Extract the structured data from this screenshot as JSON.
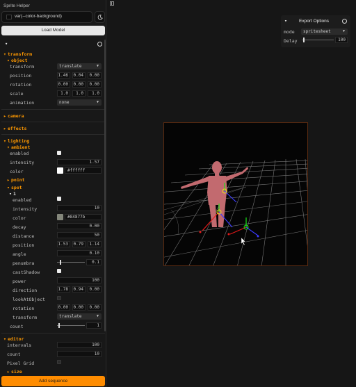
{
  "app": {
    "title": "Sprite Helper"
  },
  "background": {
    "value": "var(--color-background)"
  },
  "buttons": {
    "load_model": "Load Model",
    "add_sequence": "Add sequence"
  },
  "gui": {
    "transform_folder": "transform",
    "object_folder": "object",
    "object": {
      "transform_label": "transform",
      "transform_value": "translate",
      "position_label": "position",
      "position": [
        "1.46",
        "0.04",
        "0.00"
      ],
      "rotation_label": "rotation",
      "rotation": [
        "0.00",
        "0.00",
        "0.00"
      ],
      "scale_label": "scale",
      "scale": [
        "1.0",
        "1.0",
        "1.0"
      ],
      "animation_label": "animation",
      "animation_value": "none"
    },
    "camera_folder": "camera",
    "effects_folder": "effects",
    "lighting_folder": "lighting",
    "ambient_folder": "ambient",
    "ambient": {
      "enabled_label": "enabled",
      "enabled": true,
      "intensity_label": "intensity",
      "intensity": "1.57",
      "color_label": "color",
      "color": "#ffffff"
    },
    "point_folder": "point",
    "spot_folder": "spot",
    "spot_sub_folder": "1",
    "spot": {
      "enabled_label": "enabled",
      "enabled": true,
      "intensity_label": "intensity",
      "intensity": "10",
      "color_label": "color",
      "color": "#84877b",
      "decay_label": "decay",
      "decay": "0.00",
      "distance_label": "distance",
      "distance": "50",
      "position_label": "position",
      "position": [
        "1.53",
        "0.79",
        "1.14"
      ],
      "angle_label": "angle",
      "angle": "0.10",
      "penumbra_label": "penumbra",
      "penumbra": "0.1",
      "penumbra_level": 0.1,
      "castshadow_label": "castShadow",
      "castshadow": true,
      "power_label": "power",
      "power": "100",
      "direction_label": "direction",
      "direction": [
        "1.78",
        "0.94",
        "0.00"
      ],
      "lookatobject_label": "lookAtObject",
      "lookatobject": false,
      "rotation_label": "rotation",
      "rotation": [
        "0.00",
        "0.00",
        "0.00"
      ],
      "transform_label": "transform",
      "transform_value": "translate"
    },
    "count_label": "count",
    "count": "1",
    "count_level": 0.05,
    "editor_folder": "editor",
    "editor": {
      "intervals_label": "intervals",
      "intervals": "100",
      "count_label": "count",
      "count": "10",
      "pixelgrid_label": "Pixel Grid",
      "pixelgrid": false
    },
    "size_folder": "size"
  },
  "export": {
    "title": "Export Options",
    "mode_label": "mode",
    "mode_value": "spritesheet",
    "delay_label": "Delay",
    "delay": "100",
    "delay_level": 0.05
  },
  "colors": {
    "accent": "#ff9900",
    "button_orange": "#ff8c00",
    "spot_color": "#84877b",
    "figure": "#c26a6f"
  }
}
